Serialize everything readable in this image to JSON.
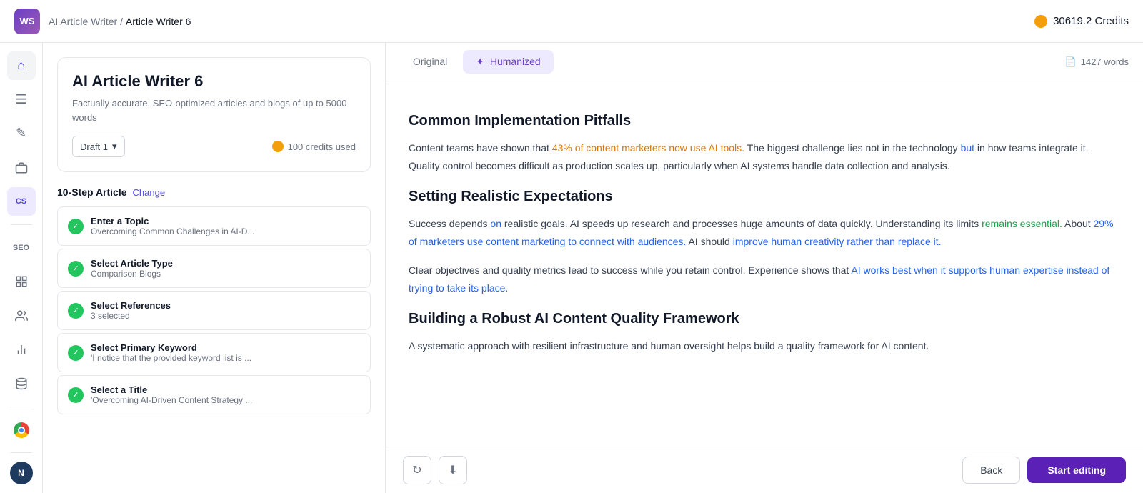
{
  "topbar": {
    "logo": "WS",
    "breadcrumb_part1": "AI Article Writer",
    "breadcrumb_separator": " / ",
    "breadcrumb_part2": "Article Writer 6",
    "credits_label": "30619.2 Credits"
  },
  "sidebar": {
    "icons": [
      {
        "name": "home-icon",
        "symbol": "⌂"
      },
      {
        "name": "bookmark-icon",
        "symbol": "☰"
      },
      {
        "name": "edit-icon",
        "symbol": "✎"
      },
      {
        "name": "briefcase-icon",
        "symbol": "💼"
      },
      {
        "name": "cs-icon",
        "symbol": "CS"
      },
      {
        "name": "seo-icon",
        "symbol": "SEO"
      },
      {
        "name": "chart-bar-icon",
        "symbol": "▦"
      },
      {
        "name": "users-icon",
        "symbol": "👥"
      },
      {
        "name": "analytics-icon",
        "symbol": "📊"
      },
      {
        "name": "data-icon",
        "symbol": "🗂"
      },
      {
        "name": "chrome-icon",
        "symbol": "chrome"
      },
      {
        "name": "user-avatar",
        "symbol": "N"
      }
    ]
  },
  "left_panel": {
    "tool_title": "AI Article Writer 6",
    "tool_desc": "Factually accurate, SEO-optimized articles and blogs of up to 5000 words",
    "draft_label": "Draft 1",
    "credits_used": "100 credits used",
    "steps_title": "10-Step Article",
    "steps_change": "Change",
    "steps": [
      {
        "name": "Enter a Topic",
        "value": "Overcoming Common Challenges in AI-D..."
      },
      {
        "name": "Select Article Type",
        "value": "Comparison Blogs"
      },
      {
        "name": "Select References",
        "value": "3 selected"
      },
      {
        "name": "Select Primary Keyword",
        "value": "'I notice that the provided keyword list is ..."
      },
      {
        "name": "Select a Title",
        "value": "'Overcoming AI-Driven Content Strategy ..."
      }
    ]
  },
  "content": {
    "tab_original": "Original",
    "tab_humanized": "Humanized",
    "tab_active": "Humanized",
    "word_count": "1427 words",
    "sections": [
      {
        "heading": "Common Implementation Pitfalls",
        "paragraphs": [
          "Content teams have shown that 43% of content marketers now use AI tools. The biggest challenge lies not in the technology but in how teams integrate it. Quality control becomes difficult as production scales up, particularly when AI systems handle data collection and analysis."
        ]
      },
      {
        "heading": "Setting Realistic Expectations",
        "paragraphs": [
          "Success depends on realistic goals. AI speeds up research and processes huge amounts of data quickly. Understanding its limits remains essential. About 29% of marketers use content marketing to connect with audiences. AI should improve human creativity rather than replace it.",
          "Clear objectives and quality metrics lead to success while you retain control. Experience shows that AI works best when it supports human expertise instead of trying to take its place."
        ]
      },
      {
        "heading": "Building a Robust AI Content Quality Framework",
        "paragraphs": [
          "A systematic approach with resilient infrastructure and human oversight helps build a quality framework for AI content."
        ]
      }
    ],
    "refresh_btn": "↻",
    "download_btn": "⬇",
    "back_btn": "Back",
    "start_editing_btn": "Start editing"
  }
}
